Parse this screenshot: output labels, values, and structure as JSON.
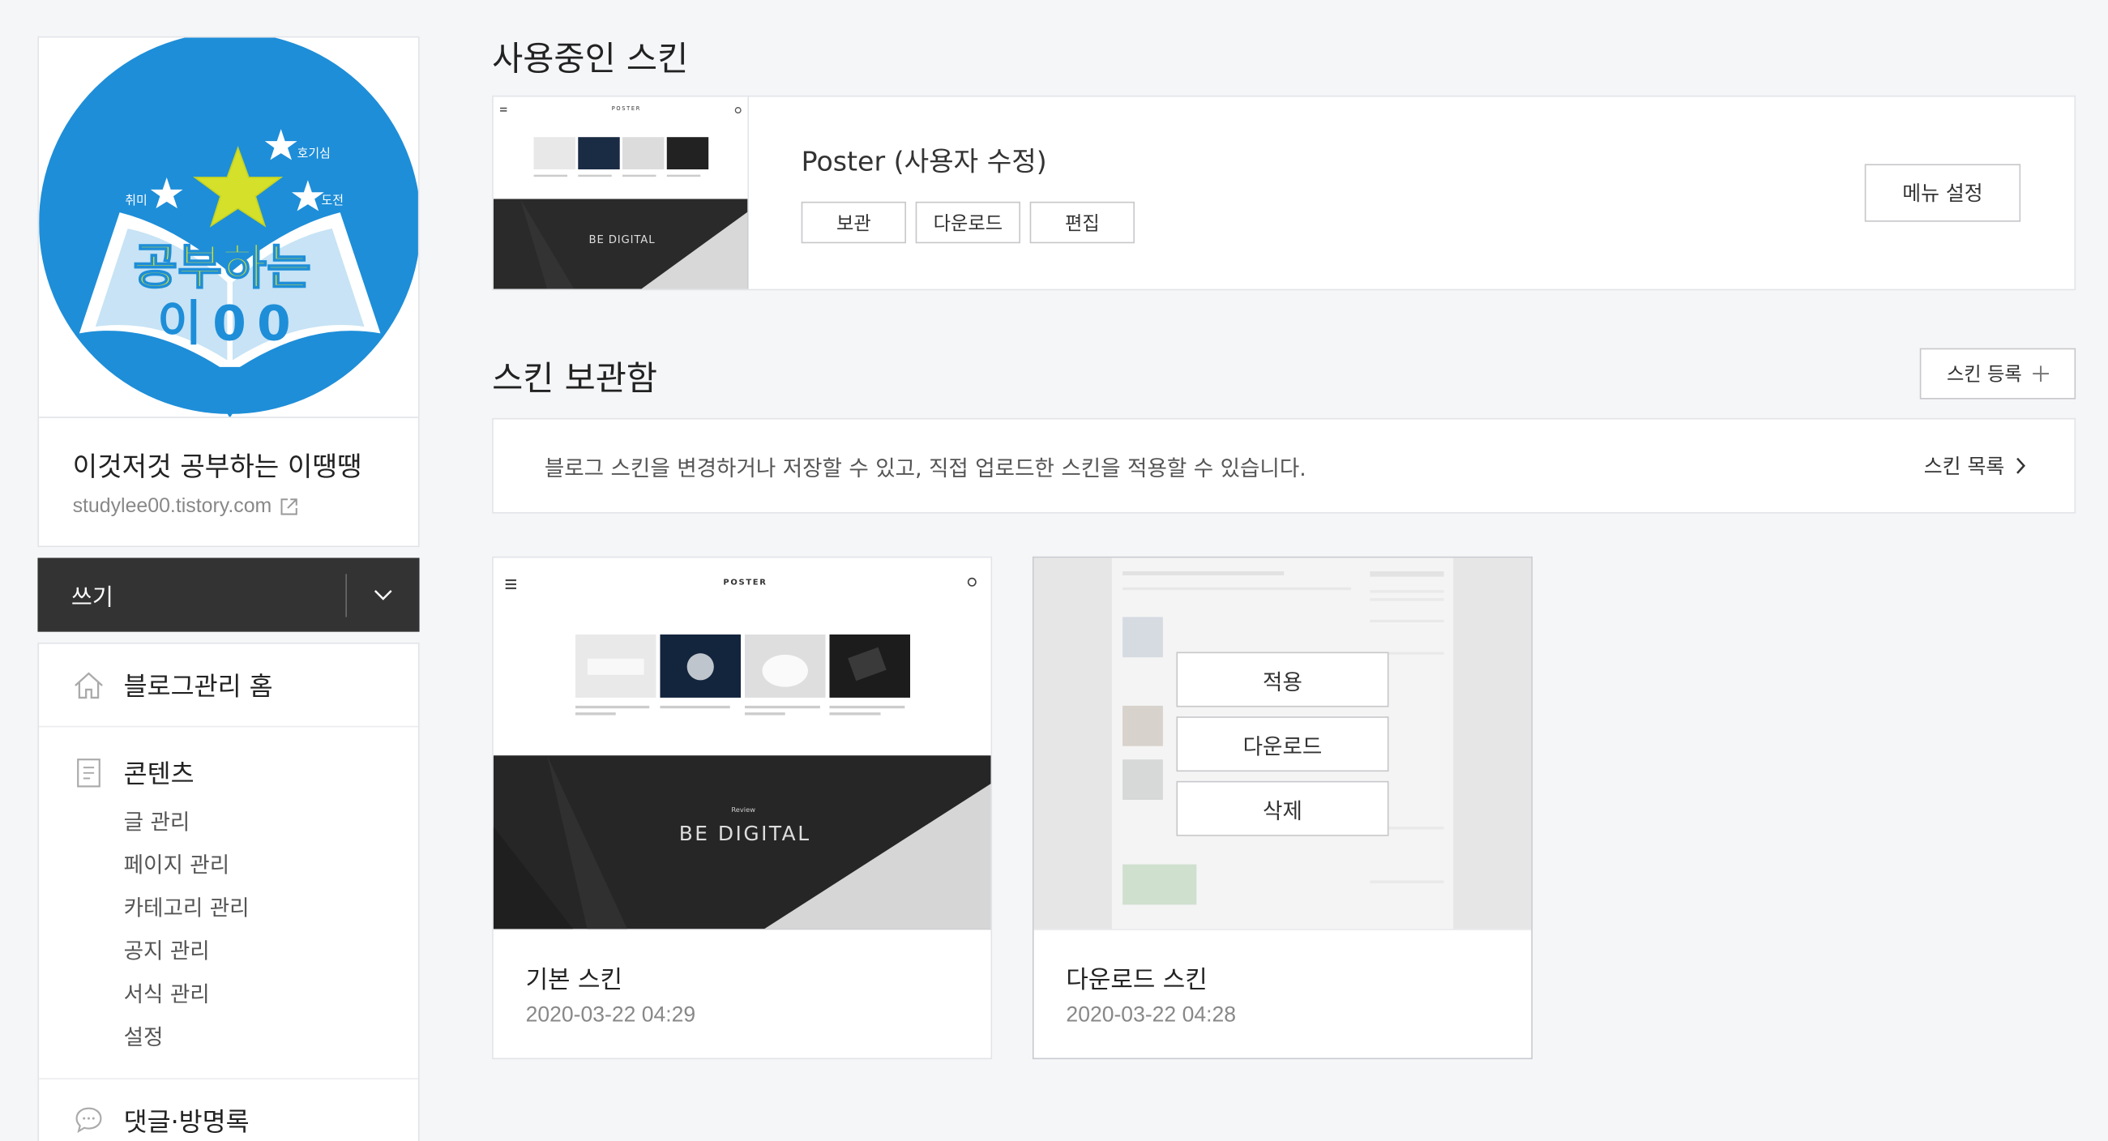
{
  "sidebar": {
    "blog_name": "이것저것 공부하는 이땡땡",
    "blog_url": "studylee00.tistory.com",
    "logo_text_top": "공부하는",
    "logo_text_bottom": "이00",
    "logo_tags": [
      "호기심",
      "취미",
      "도전"
    ],
    "write_label": "쓰기",
    "home_label": "블로그관리 홈",
    "contents_label": "콘텐츠",
    "contents_items": [
      "글 관리",
      "페이지 관리",
      "카테고리 관리",
      "공지 관리",
      "서식 관리",
      "설정"
    ],
    "comments_label": "댓글·방명록"
  },
  "current_skin": {
    "section_title": "사용중인 스킨",
    "name": "Poster (사용자 수정)",
    "actions": [
      "보관",
      "다운로드",
      "편집"
    ],
    "menu_setting_label": "메뉴 설정",
    "thumb_brand": "POSTER",
    "thumb_banner": "BE DIGITAL"
  },
  "storage": {
    "section_title": "스킨 보관함",
    "register_label": "스킨 등록",
    "info_text": "블로그 스킨을 변경하거나 저장할 수 있고, 직접 업로드한 스킨을 적용할 수 있습니다.",
    "list_link_label": "스킨 목록",
    "skins": [
      {
        "name": "기본 스킨",
        "date": "2020-03-22 04:29",
        "thumb_brand": "POSTER",
        "thumb_banner_small": "Review",
        "thumb_banner": "BE DIGITAL"
      },
      {
        "name": "다운로드 스킨",
        "date": "2020-03-22 04:28",
        "overlay_actions": [
          "적용",
          "다운로드",
          "삭제"
        ]
      }
    ]
  },
  "colors": {
    "logo_blue": "#1e8ed8",
    "logo_yellow": "#d4e02a",
    "write_bg": "#333333",
    "page_bg": "#f5f6f8"
  }
}
